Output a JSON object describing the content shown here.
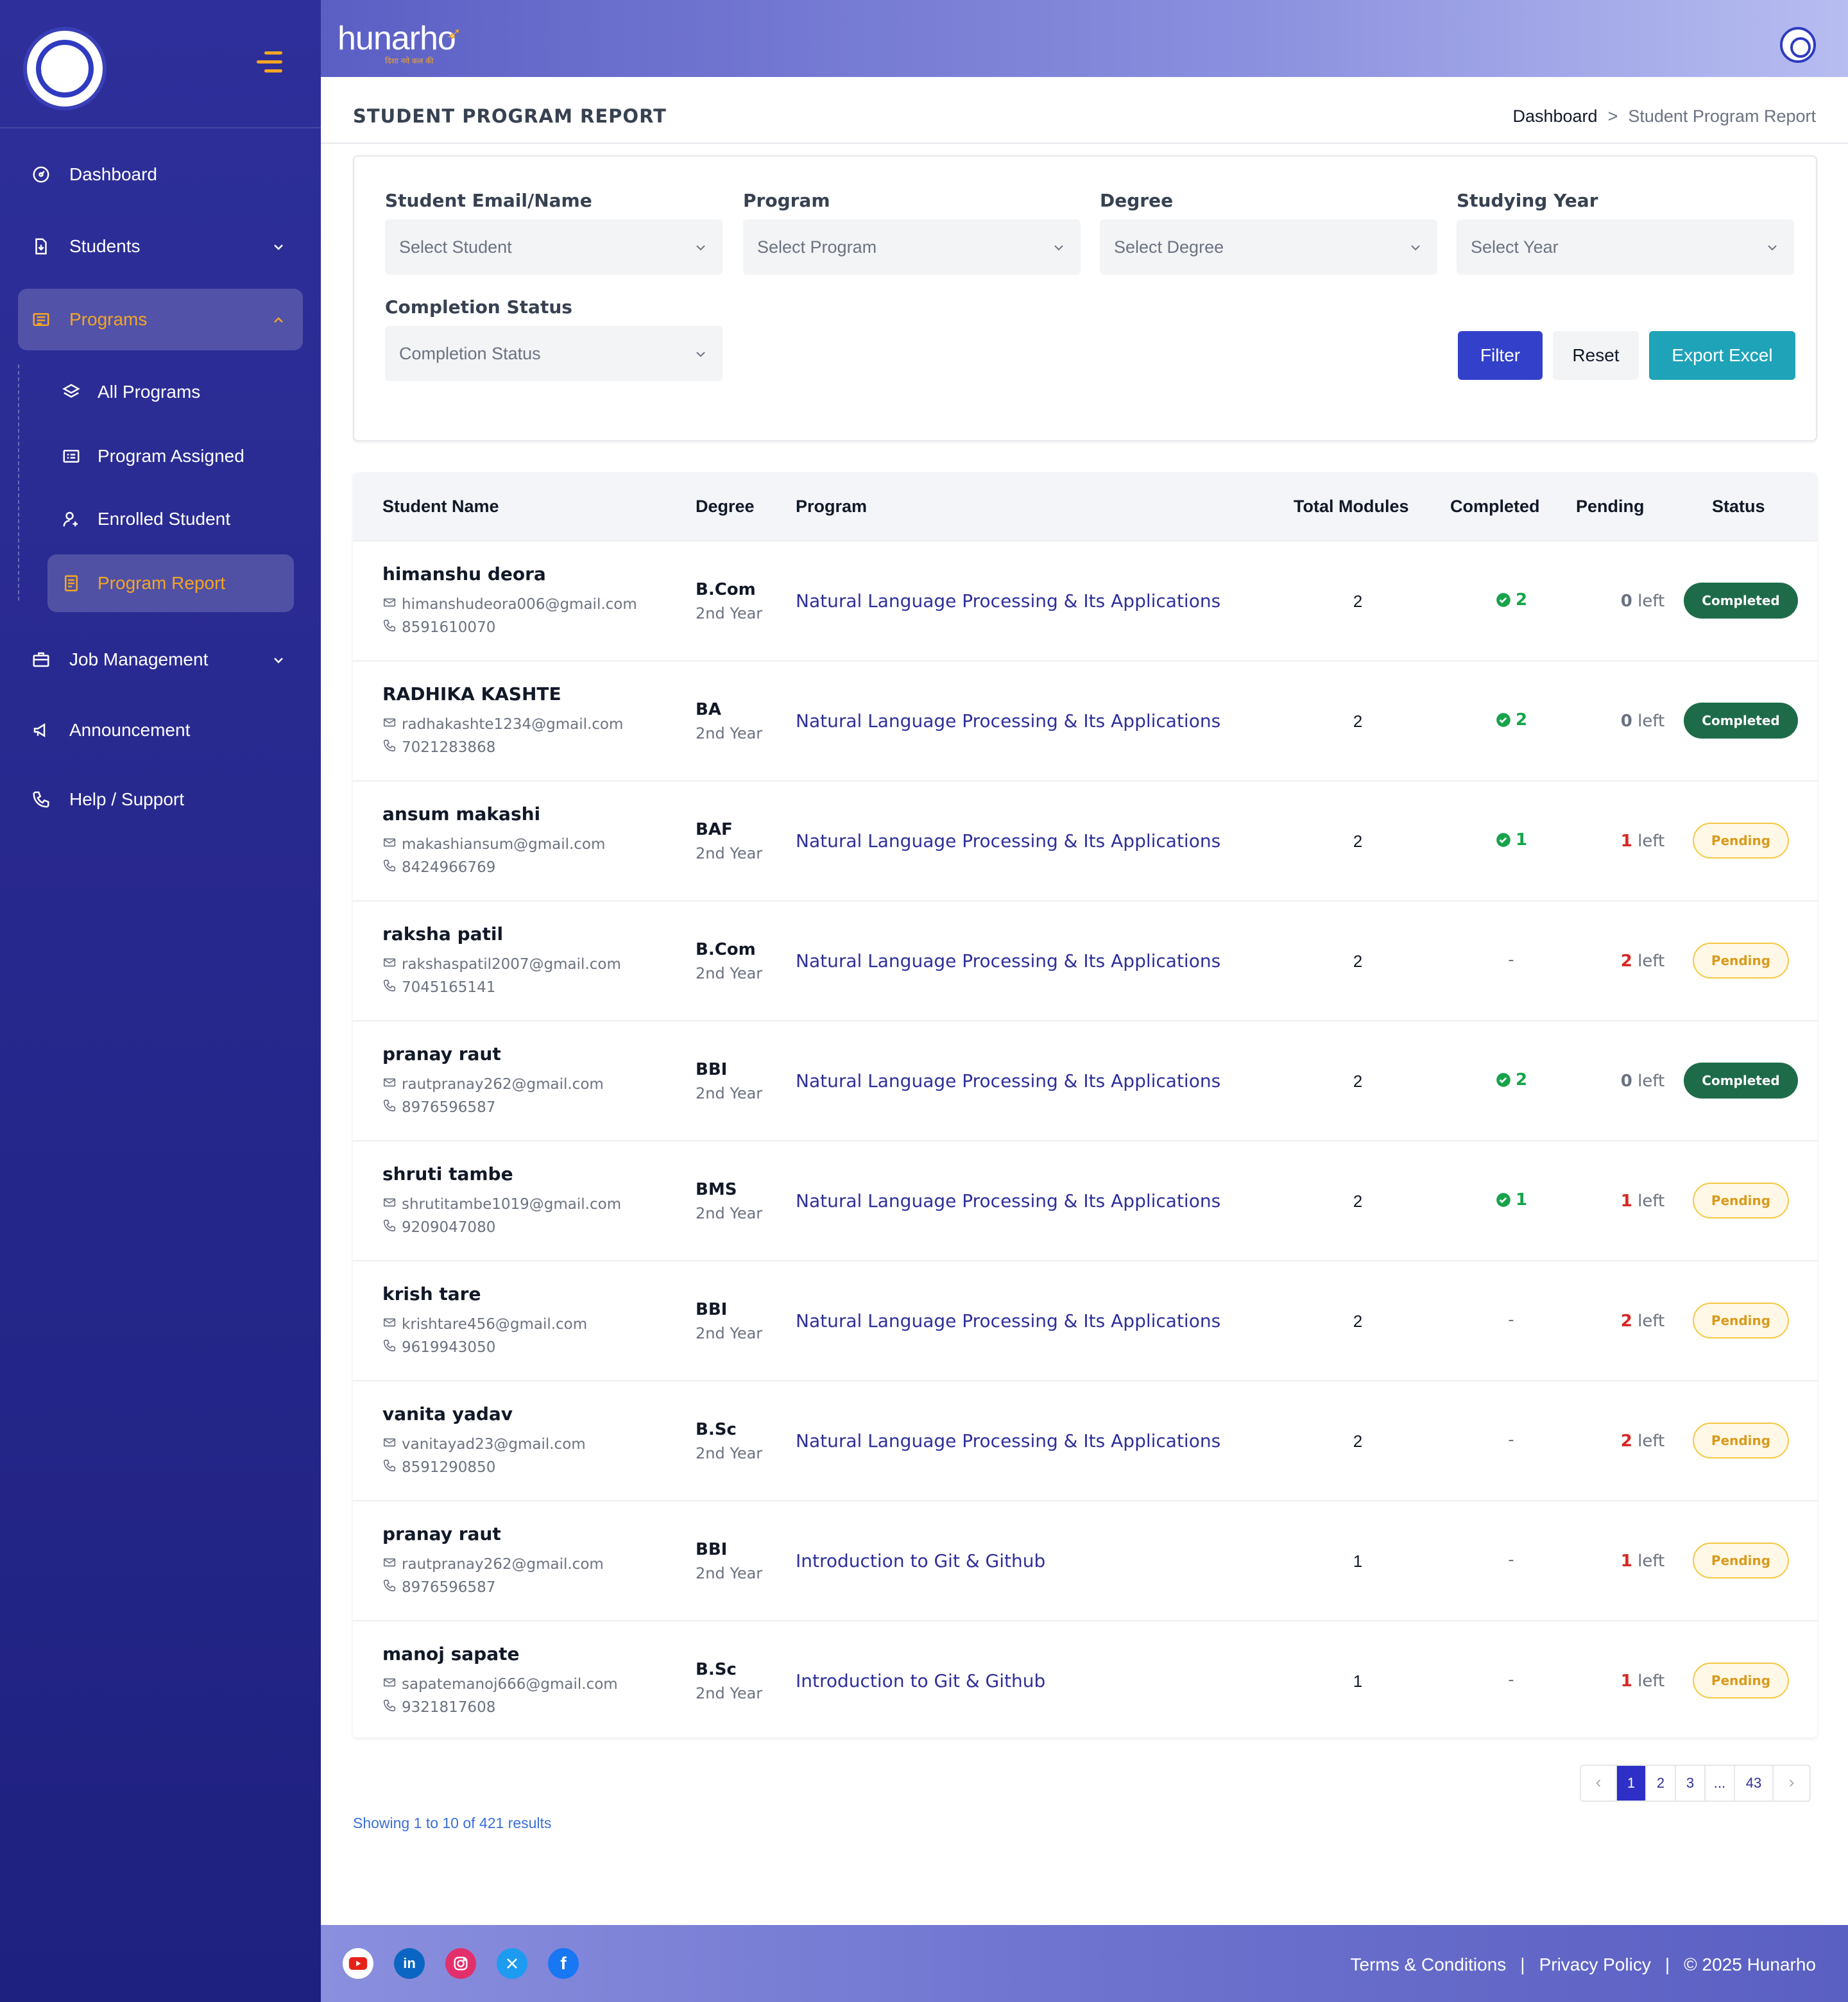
{
  "app": {
    "brand": "hunarho",
    "brand_tagline": "दिशा नये कल की"
  },
  "sidebar": {
    "items": [
      {
        "label": "Dashboard",
        "icon": "dashboard-icon"
      },
      {
        "label": "Students",
        "icon": "student-file-icon"
      },
      {
        "label": "Programs",
        "icon": "programs-icon"
      },
      {
        "label": "Job Management",
        "icon": "briefcase-icon"
      },
      {
        "label": "Announcement",
        "icon": "megaphone-icon"
      },
      {
        "label": "Help / Support",
        "icon": "phone-icon"
      }
    ],
    "sub_items": [
      {
        "label": "All Programs",
        "icon": "layers-icon"
      },
      {
        "label": "Program Assigned",
        "icon": "list-card-icon"
      },
      {
        "label": "Enrolled Student",
        "icon": "user-plus-icon"
      },
      {
        "label": "Program Report",
        "icon": "report-icon"
      }
    ],
    "active_sub": "Program Report",
    "accent_color": "#f5a524"
  },
  "page": {
    "title": "STUDENT PROGRAM REPORT",
    "breadcrumb": {
      "home": "Dashboard",
      "separator": ">",
      "current": "Student Program Report"
    }
  },
  "filters": {
    "student": {
      "label": "Student Email/Name",
      "placeholder": "Select Student"
    },
    "program": {
      "label": "Program",
      "placeholder": "Select Program"
    },
    "degree": {
      "label": "Degree",
      "placeholder": "Select Degree"
    },
    "year": {
      "label": "Studying Year",
      "placeholder": "Select Year"
    },
    "completion": {
      "label": "Completion Status",
      "placeholder": "Completion Status"
    },
    "buttons": {
      "filter": "Filter",
      "reset": "Reset",
      "export": "Export Excel"
    }
  },
  "table": {
    "headers": {
      "student_name": "Student Name",
      "degree": "Degree",
      "program": "Program",
      "total_modules": "Total Modules",
      "completed": "Completed",
      "pending": "Pending",
      "status": "Status"
    },
    "rows": [
      {
        "name": "himanshu deora",
        "email": "himanshudeora006@gmail.com",
        "phone": "8591610070",
        "degree": "B.Com",
        "year": "2nd Year",
        "program": "Natural Language Processing & Its Applications",
        "total": "2",
        "completed": "2",
        "pending_count": "0",
        "pending_suffix": "left",
        "status": "Completed"
      },
      {
        "name": "RADHIKA KASHTE",
        "email": "radhakashte1234@gmail.com",
        "phone": "7021283868",
        "degree": "BA",
        "year": "2nd Year",
        "program": "Natural Language Processing & Its Applications",
        "total": "2",
        "completed": "2",
        "pending_count": "0",
        "pending_suffix": "left",
        "status": "Completed"
      },
      {
        "name": "ansum makashi",
        "email": "makashiansum@gmail.com",
        "phone": "8424966769",
        "degree": "BAF",
        "year": "2nd Year",
        "program": "Natural Language Processing & Its Applications",
        "total": "2",
        "completed": "1",
        "pending_count": "1",
        "pending_suffix": "left",
        "status": "Pending"
      },
      {
        "name": "raksha patil",
        "email": "rakshaspatil2007@gmail.com",
        "phone": "7045165141",
        "degree": "B.Com",
        "year": "2nd Year",
        "program": "Natural Language Processing & Its Applications",
        "total": "2",
        "completed": "-",
        "pending_count": "2",
        "pending_suffix": "left",
        "status": "Pending"
      },
      {
        "name": "pranay raut",
        "email": "rautpranay262@gmail.com",
        "phone": "8976596587",
        "degree": "BBI",
        "year": "2nd Year",
        "program": "Natural Language Processing & Its Applications",
        "total": "2",
        "completed": "2",
        "pending_count": "0",
        "pending_suffix": "left",
        "status": "Completed"
      },
      {
        "name": "shruti tambe",
        "email": "shrutitambe1019@gmail.com",
        "phone": "9209047080",
        "degree": "BMS",
        "year": "2nd Year",
        "program": "Natural Language Processing & Its Applications",
        "total": "2",
        "completed": "1",
        "pending_count": "1",
        "pending_suffix": "left",
        "status": "Pending"
      },
      {
        "name": "krish tare",
        "email": "krishtare456@gmail.com",
        "phone": "9619943050",
        "degree": "BBI",
        "year": "2nd Year",
        "program": "Natural Language Processing & Its Applications",
        "total": "2",
        "completed": "-",
        "pending_count": "2",
        "pending_suffix": "left",
        "status": "Pending"
      },
      {
        "name": "vanita yadav",
        "email": "vanitayad23@gmail.com",
        "phone": "8591290850",
        "degree": "B.Sc",
        "year": "2nd Year",
        "program": "Natural Language Processing & Its Applications",
        "total": "2",
        "completed": "-",
        "pending_count": "2",
        "pending_suffix": "left",
        "status": "Pending"
      },
      {
        "name": "pranay raut",
        "email": "rautpranay262@gmail.com",
        "phone": "8976596587",
        "degree": "BBI",
        "year": "2nd Year",
        "program": "Introduction to Git & Github",
        "total": "1",
        "completed": "-",
        "pending_count": "1",
        "pending_suffix": "left",
        "status": "Pending"
      },
      {
        "name": "manoj sapate",
        "email": "sapatemanoj666@gmail.com",
        "phone": "9321817608",
        "degree": "B.Sc",
        "year": "2nd Year",
        "program": "Introduction to Git & Github",
        "total": "1",
        "completed": "-",
        "pending_count": "1",
        "pending_suffix": "left",
        "status": "Pending"
      }
    ]
  },
  "pagination": {
    "pages": [
      "1",
      "2",
      "3",
      "...",
      "43"
    ],
    "active": "1",
    "showing": "Showing 1 to 10 of 421 results"
  },
  "footer": {
    "social": [
      "youtube-icon",
      "linkedin-icon",
      "instagram-icon",
      "x-icon",
      "facebook-icon"
    ],
    "links": [
      "Terms & Conditions",
      "Privacy Policy"
    ],
    "separator": "|",
    "copyright": "© 2025 Hunarho"
  },
  "colors": {
    "primary": "#2e2f9a",
    "completed_badge": "#1e6b4a",
    "pending_badge": "#f5c842",
    "export": "#1fa3b8"
  }
}
